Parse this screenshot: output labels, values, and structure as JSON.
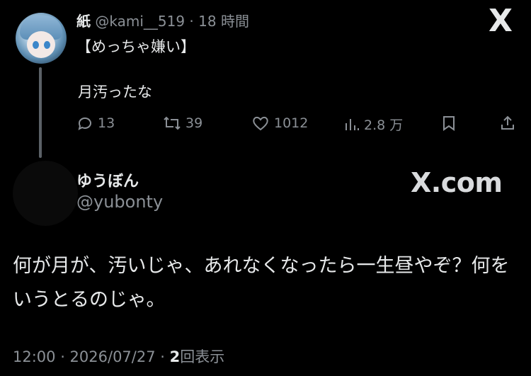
{
  "original": {
    "name": "紙",
    "handle": "@kami__519",
    "separator": "·",
    "time": "18 時間",
    "line1": "【めっちゃ嫌い】",
    "line2": "月汚ったな",
    "replies": "13",
    "retweets": "39",
    "likes": "1012",
    "views": "2.8 万"
  },
  "logo": "X",
  "reply": {
    "name": "ゆうぼん",
    "handle": "@yubonty",
    "watermark": "X.com",
    "text": "何が月が、汚いじゃ、あれなくなったら一生昼やぞ？何をいうとるのじゃ。",
    "timestamp": "12:00 · 2026/07/27 · ",
    "view_count": "2",
    "view_label": "回表示"
  },
  "icons": {
    "reply": "speech-bubble-icon",
    "retweet": "retweet-icon",
    "like": "heart-icon",
    "views": "bar-chart-icon",
    "bookmark": "bookmark-icon",
    "share": "share-icon"
  }
}
